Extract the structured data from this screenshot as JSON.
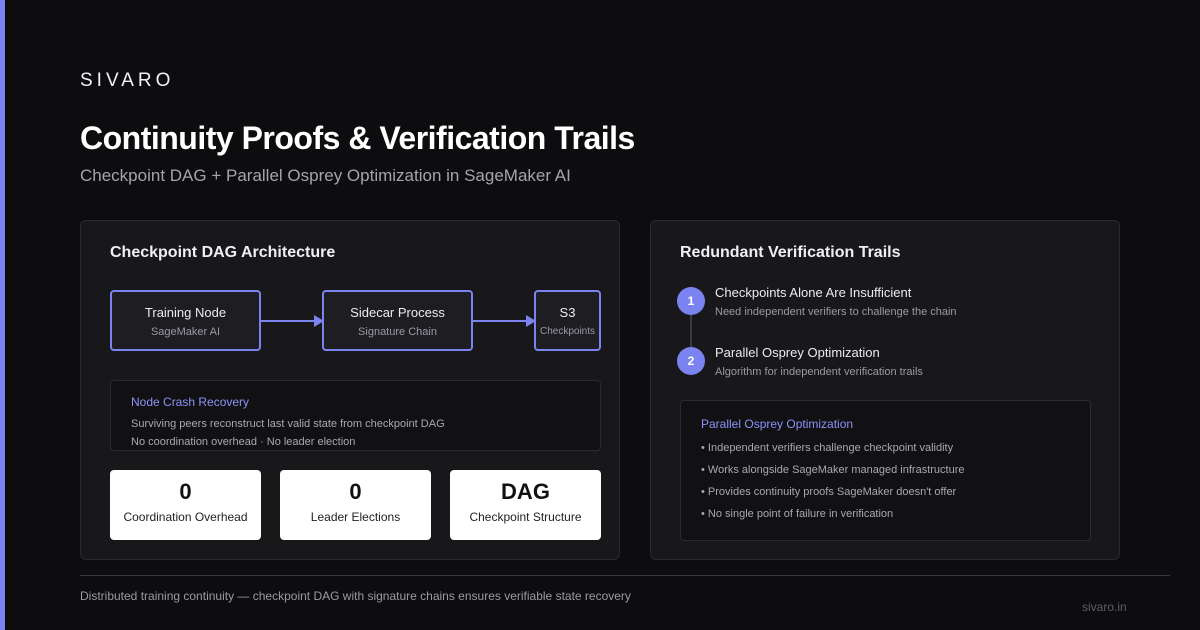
{
  "brand": "SIVARO",
  "title": "Continuity Proofs & Verification Trails",
  "subtitle": "Checkpoint DAG + Parallel Osprey Optimization in SageMaker AI",
  "colors": {
    "accent": "#7b83f0",
    "background": "#0d0d0f",
    "panel": "#18181b"
  },
  "left_panel": {
    "title": "Checkpoint DAG Architecture",
    "nodes": [
      {
        "name": "Training Node",
        "sub": "SageMaker AI"
      },
      {
        "name": "Sidecar Process",
        "sub": "Signature Chain"
      },
      {
        "name": "S3",
        "sub": "Checkpoints"
      }
    ],
    "recovery": {
      "title": "Node Crash Recovery",
      "line1": "Surviving peers reconstruct last valid state from checkpoint DAG",
      "line2": "No coordination overhead · No leader election"
    },
    "stats": [
      {
        "value": "0",
        "label": "Coordination Overhead"
      },
      {
        "value": "0",
        "label": "Leader Elections"
      },
      {
        "value": "DAG",
        "label": "Checkpoint Structure"
      }
    ]
  },
  "right_panel": {
    "title": "Redundant Verification Trails",
    "steps": [
      {
        "num": "1",
        "title": "Checkpoints Alone Are Insufficient",
        "desc": "Need independent verifiers to challenge the chain"
      },
      {
        "num": "2",
        "title": "Parallel Osprey Optimization",
        "desc": "Algorithm for independent verification trails"
      }
    ],
    "osprey": {
      "title": "Parallel Osprey Optimization",
      "items": [
        "• Independent verifiers challenge checkpoint validity",
        "• Works alongside SageMaker managed infrastructure",
        "• Provides continuity proofs SageMaker doesn't offer",
        "• No single point of failure in verification"
      ]
    }
  },
  "footer": {
    "text": "Distributed training continuity — checkpoint DAG with signature chains ensures verifiable state recovery",
    "url": "sivaro.in"
  }
}
